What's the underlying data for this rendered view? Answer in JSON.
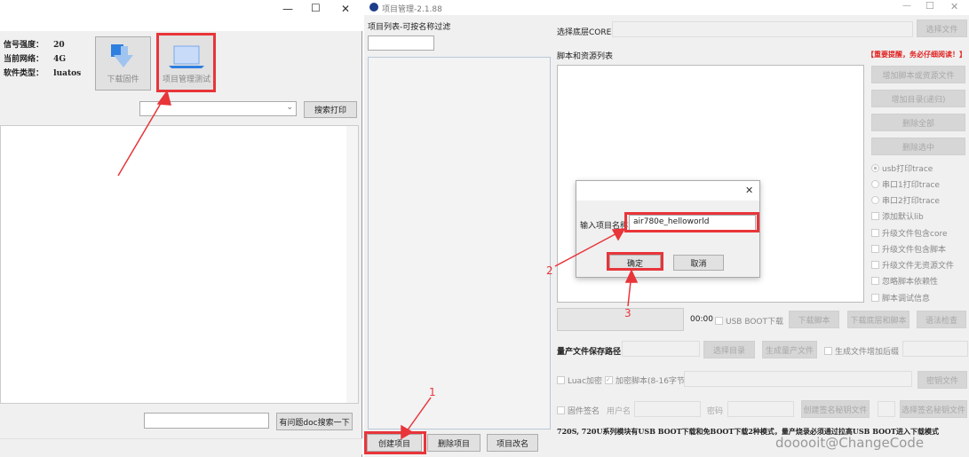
{
  "left_window": {
    "controls": {
      "minimize": "—",
      "maximize": "☐",
      "close": "✕"
    },
    "info": [
      {
        "label": "信号强度：",
        "value": "20"
      },
      {
        "label": "当前网络：",
        "value": "4G"
      },
      {
        "label": "软件类型：",
        "value": "luatos"
      }
    ],
    "download_firmware_label": "下载固件",
    "project_manager_label": "项目管理测试",
    "search_print_label": "搜索打印",
    "doc_search_label": "有问题doc搜索一下",
    "combo_value": "",
    "doc_search_value": ""
  },
  "right_window": {
    "title": "项目管理-2.1.88",
    "project_list_label": "项目列表-可按名称过滤",
    "filter_value": "",
    "create_project": "创建项目",
    "delete_project": "删除项目",
    "rename_project": "项目改名",
    "core_label": "选择底层CORE",
    "core_value": "",
    "select_file": "选择文件",
    "script_list_label": "脚本和资源列表",
    "warning": "【重要提醒，务必仔细阅读！】",
    "side_buttons": [
      "增加脚本或资源文件",
      "增加目录(递归)",
      "删除全部",
      "删除选中"
    ],
    "radios": [
      {
        "label": "usb打印trace",
        "checked": true
      },
      {
        "label": "串口1打印trace",
        "checked": false
      },
      {
        "label": "串口2打印trace",
        "checked": false
      }
    ],
    "checkboxes": [
      "添加默认lib",
      "升级文件包含core",
      "升级文件包含脚本",
      "升级文件无资源文件",
      "忽略脚本依赖性",
      "脚本调试信息"
    ],
    "timer": "00:00",
    "usb_boot_label": "USB BOOT下载",
    "download_script": "下载脚本",
    "download_core_script": "下载底层和脚本",
    "syntax_check": "语法检查",
    "mass_path_label": "量产文件保存路径",
    "select_dir": "选择目录",
    "gen_mass": "生成量产文件",
    "gen_suffix_label": "生成文件增加后缀",
    "luac_label": "Luac加密",
    "encrypt_label": "加密脚本(8-16字节)",
    "key_file": "密钥文件",
    "fw_sign_label": "固件签名",
    "username_label": "用户名",
    "password_label": "密码",
    "create_sign_key": "创建签名秘钥文件",
    "select_sign_key": "选择签名秘钥文件",
    "notice": "720S, 720U系列模块有USB BOOT下载和免BOOT下载2种模式，量产烧录必须通过拉高USB BOOT进入下载模式"
  },
  "dialog": {
    "label": "输入项目名称",
    "value": "air780e_helloworld",
    "ok": "确定",
    "cancel": "取消"
  },
  "annotations": {
    "step1": "1",
    "step2": "2",
    "step3": "3",
    "accent": "#e8353a"
  },
  "watermark": "dooooit@ChangeCode"
}
